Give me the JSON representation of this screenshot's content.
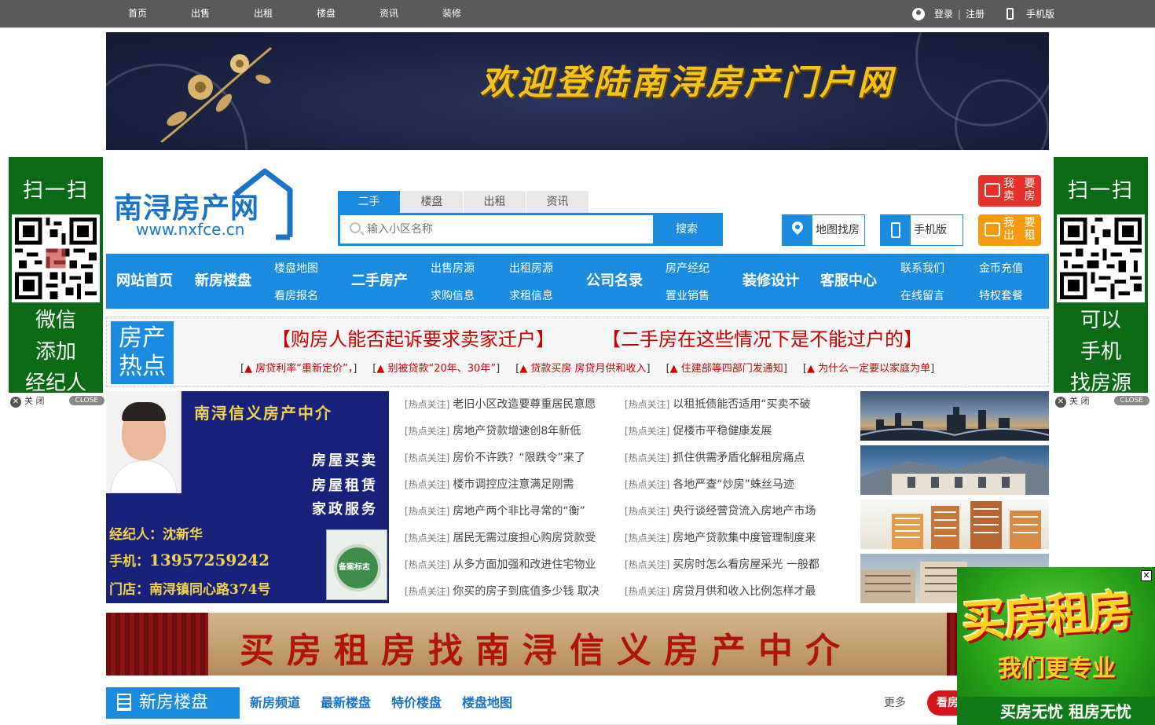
{
  "topbar": {
    "nav": [
      "首页",
      "出售",
      "出租",
      "楼盘",
      "资讯",
      "装修"
    ],
    "login": "登录",
    "sep": "|",
    "register": "注册",
    "mobile": "手机版"
  },
  "banner1": {
    "title": "欢迎登陆南浔房产门户网"
  },
  "side_left": {
    "scan": "扫一扫",
    "l1": "微信",
    "l2": "添加",
    "l3": "经纪人",
    "close": "关 闭",
    "close_en": "CLOSE"
  },
  "side_right": {
    "scan": "扫一扫",
    "l1": "可以",
    "l2": "手机",
    "l3": "找房源",
    "close": "关 闭",
    "close_en": "CLOSE"
  },
  "logo": {
    "name": "南浔房产网",
    "url": "www.nxfce.cn"
  },
  "search": {
    "tabs": [
      "二手",
      "楼盘",
      "出租",
      "资讯"
    ],
    "placeholder": "输入小区名称",
    "button": "搜索"
  },
  "quick": {
    "map": "地图找房",
    "mobile": "手机版"
  },
  "actions": {
    "sell": [
      "我 要",
      "卖 房"
    ],
    "rent": [
      "我 要",
      "出 租"
    ]
  },
  "mainnav": {
    "home": "网站首页",
    "newhouse": "新房楼盘",
    "map": "楼盘地图",
    "signup": "看房报名",
    "secondhand": "二手房产",
    "sale": "出售房源",
    "buy": "求购信息",
    "rent": "出租房源",
    "wantrent": "求租信息",
    "company": "公司名录",
    "agent": "房产经纪",
    "sales": "置业销售",
    "decor": "装修设计",
    "service": "客服中心",
    "contact": "联系我们",
    "msg": "在线留言",
    "coin": "金币充值",
    "vip": "特权套餐"
  },
  "hot": {
    "badge1": "房产",
    "badge2": "热点",
    "h1": "【购房人能否起诉要求卖家迁户】",
    "h2": "【二手房在这些情况下是不能过户的】",
    "subs": [
      "房贷利率“重新定价”，",
      "别被贷款“20年、30年”",
      "贷款买房 房贷月供和收入",
      "住建部等四部门发通知",
      "为什么一定要以家庭为单"
    ]
  },
  "agent_card": {
    "title": "南浔信义房产中介",
    "svc1": "房屋买卖",
    "svc2": "房屋租赁",
    "svc3": "家政服务",
    "agent_label": "经纪人：沈新华",
    "phone_label": "手机：",
    "phone": "13957259242",
    "store": "门店：南浔镇同心路374号",
    "seal": "备案标志"
  },
  "news_tag": "[热点关注]",
  "news_left": [
    "老旧小区改造要尊重居民意愿",
    "房地产贷款增速创8年新低",
    "房价不许跌？“限跌令”来了",
    "楼市调控应注意满足刚需",
    "房地产两个非比寻常的“衡”",
    "居民无需过度担心购房贷款受",
    "从多方面加强和改进住宅物业",
    "你买的房子到底值多少钱 取决"
  ],
  "news_right": [
    "以租抵债能否适用“买卖不破",
    "促楼市平稳健康发展",
    "抓住供需矛盾化解租房痛点",
    "各地严查“炒房”蛛丝马迹",
    "央行谈经营贷流入房地产市场",
    "房地产贷款集中度管理制度来",
    "买房时怎么看房屋采光 一般都",
    "房贷月供和收入比例怎样才最"
  ],
  "banner2": {
    "title": "买房租房找南浔信义房产中介"
  },
  "newsec": {
    "title": "新房楼盘",
    "links": [
      "新房频道",
      "最新楼盘",
      "特价楼盘",
      "楼盘地图"
    ],
    "more": "更多",
    "view": "看房"
  },
  "popad": {
    "t1": "买房租房",
    "t2": "我们更专业",
    "t3": "买房无忧 租房无忧"
  }
}
